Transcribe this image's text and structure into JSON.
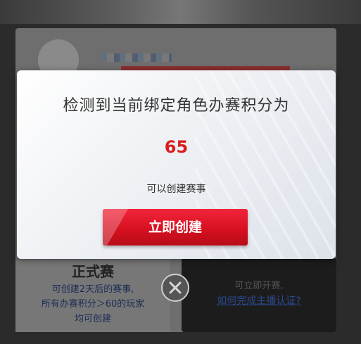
{
  "dialog": {
    "title": "检测到当前绑定角色办赛积分为",
    "score": "65",
    "subtitle": "可以创建赛事",
    "create_button": "立即创建"
  },
  "background": {
    "left_card": {
      "title": "正式赛",
      "desc_line1": "可创建2天后的赛事,",
      "desc_line2": "所有办赛积分＞60的玩家",
      "desc_line3": "均可创建"
    },
    "right_card": {
      "desc": "可立即开赛,",
      "link": "如何完成主播认证?"
    }
  },
  "colors": {
    "accent": "#d81e1e",
    "button": "#e01a2c"
  },
  "icons": {
    "close": "close-icon"
  }
}
